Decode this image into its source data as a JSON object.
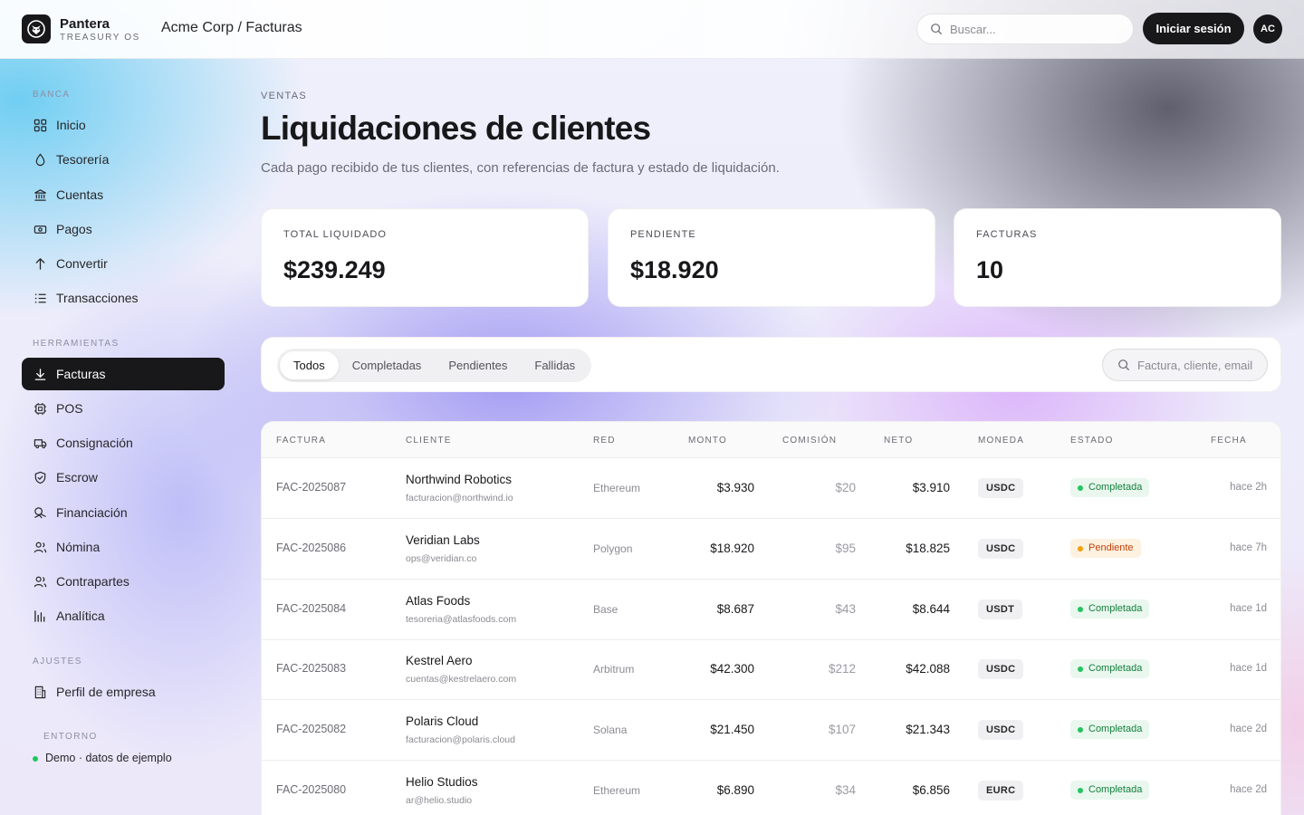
{
  "topbar": {
    "brand_name": "Pantera",
    "brand_sub": "TREASURY OS",
    "breadcrumb": "Acme Corp / Facturas",
    "search_placeholder": "Buscar...",
    "login_label": "Iniciar sesión",
    "avatar_initials": "AC"
  },
  "sidebar": {
    "banca_label": "BANCA",
    "banca_items": [
      {
        "label": "Inicio",
        "icon": "grid-icon"
      },
      {
        "label": "Tesorería",
        "icon": "drop-icon"
      },
      {
        "label": "Cuentas",
        "icon": "bank-icon"
      },
      {
        "label": "Pagos",
        "icon": "money-icon"
      },
      {
        "label": "Convertir",
        "icon": "arrow-up-icon"
      },
      {
        "label": "Transacciones",
        "icon": "list-icon"
      }
    ],
    "herramientas_label": "HERRAMIENTAS",
    "herramientas_items": [
      {
        "label": "Facturas",
        "icon": "download-icon",
        "active": true
      },
      {
        "label": "POS",
        "icon": "chip-icon"
      },
      {
        "label": "Consignación",
        "icon": "truck-icon"
      },
      {
        "label": "Escrow",
        "icon": "shield-icon"
      },
      {
        "label": "Financiación",
        "icon": "coins-icon"
      },
      {
        "label": "Nómina",
        "icon": "users-icon"
      },
      {
        "label": "Contrapartes",
        "icon": "users-icon"
      },
      {
        "label": "Analítica",
        "icon": "bar-chart-icon"
      }
    ],
    "ajustes_label": "AJUSTES",
    "ajustes_items": [
      {
        "label": "Perfil de empresa",
        "icon": "building-icon"
      }
    ],
    "entorno_label": "ENTORNO",
    "entorno_value": "Demo · datos de ejemplo"
  },
  "main": {
    "eyebrow": "VENTAS",
    "title": "Liquidaciones de clientes",
    "subtitle": "Cada pago recibido de tus clientes, con referencias de factura y estado de liquidación.",
    "stats": [
      {
        "label": "TOTAL LIQUIDADO",
        "value": "$239.249"
      },
      {
        "label": "PENDIENTE",
        "value": "$18.920"
      },
      {
        "label": "FACTURAS",
        "value": "10"
      }
    ],
    "tabs": [
      "Todos",
      "Completadas",
      "Pendientes",
      "Fallidas"
    ],
    "active_tab": "Todos",
    "filter_placeholder": "Factura, cliente, email",
    "columns": [
      "FACTURA",
      "CLIENTE",
      "RED",
      "MONTO",
      "COMISIÓN",
      "NETO",
      "MONEDA",
      "ESTADO",
      "FECHA"
    ],
    "rows": [
      {
        "invoice": "FAC-2025087",
        "client": "Northwind Robotics",
        "email": "facturacion@northwind.io",
        "network": "Ethereum",
        "amount": "$3.930",
        "fee": "$20",
        "net": "$3.910",
        "currency": "USDC",
        "status": "Completada",
        "status_type": "ok",
        "date": "hace 2h"
      },
      {
        "invoice": "FAC-2025086",
        "client": "Veridian Labs",
        "email": "ops@veridian.co",
        "network": "Polygon",
        "amount": "$18.920",
        "fee": "$95",
        "net": "$18.825",
        "currency": "USDC",
        "status": "Pendiente",
        "status_type": "pending",
        "date": "hace 7h"
      },
      {
        "invoice": "FAC-2025084",
        "client": "Atlas Foods",
        "email": "tesoreria@atlasfoods.com",
        "network": "Base",
        "amount": "$8.687",
        "fee": "$43",
        "net": "$8.644",
        "currency": "USDT",
        "status": "Completada",
        "status_type": "ok",
        "date": "hace 1d"
      },
      {
        "invoice": "FAC-2025083",
        "client": "Kestrel Aero",
        "email": "cuentas@kestrelaero.com",
        "network": "Arbitrum",
        "amount": "$42.300",
        "fee": "$212",
        "net": "$42.088",
        "currency": "USDC",
        "status": "Completada",
        "status_type": "ok",
        "date": "hace 1d"
      },
      {
        "invoice": "FAC-2025082",
        "client": "Polaris Cloud",
        "email": "facturacion@polaris.cloud",
        "network": "Solana",
        "amount": "$21.450",
        "fee": "$107",
        "net": "$21.343",
        "currency": "USDC",
        "status": "Completada",
        "status_type": "ok",
        "date": "hace 2d"
      },
      {
        "invoice": "FAC-2025080",
        "client": "Helio Studios",
        "email": "ar@helio.studio",
        "network": "Ethereum",
        "amount": "$6.890",
        "fee": "$34",
        "net": "$6.856",
        "currency": "EURC",
        "status": "Completada",
        "status_type": "ok",
        "date": "hace 2d"
      }
    ]
  },
  "colors": {
    "accent_dark": "#18181b",
    "success": "#22c55e",
    "warning": "#f59e0b"
  }
}
